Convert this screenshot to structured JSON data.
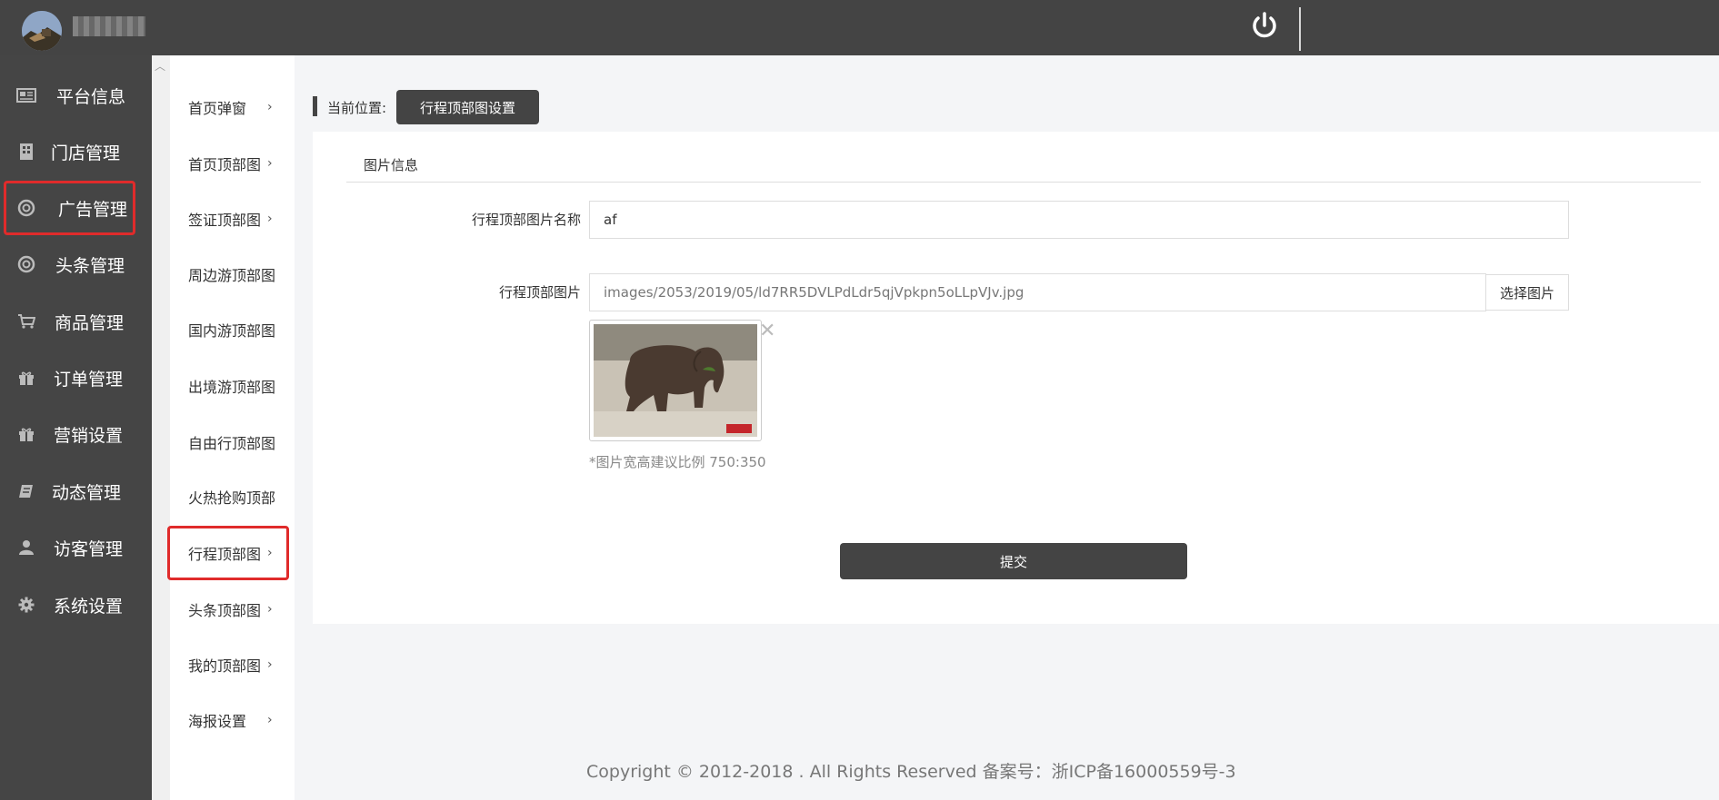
{
  "header": {
    "avatar_icon": "user-avatar",
    "power_icon": "power-icon"
  },
  "sidebar": {
    "items": [
      {
        "label": "平台信息",
        "icon": "newspaper-icon"
      },
      {
        "label": "门店管理",
        "icon": "building-icon"
      },
      {
        "label": "广告管理",
        "icon": "lifebuoy-icon",
        "active": true
      },
      {
        "label": "头条管理",
        "icon": "lifebuoy-icon"
      },
      {
        "label": "商品管理",
        "icon": "cart-icon"
      },
      {
        "label": "订单管理",
        "icon": "gift-icon"
      },
      {
        "label": "营销设置",
        "icon": "gift-icon"
      },
      {
        "label": "动态管理",
        "icon": "book-icon"
      },
      {
        "label": "访客管理",
        "icon": "user-icon"
      },
      {
        "label": "系统设置",
        "icon": "gear-icon"
      }
    ]
  },
  "subnav": {
    "items": [
      {
        "label": "首页弹窗",
        "chevron": true
      },
      {
        "label": "首页顶部图",
        "chevron": true
      },
      {
        "label": "签证顶部图",
        "chevron": true
      },
      {
        "label": "周边游顶部图",
        "chevron": false
      },
      {
        "label": "国内游顶部图",
        "chevron": false
      },
      {
        "label": "出境游顶部图",
        "chevron": false
      },
      {
        "label": "自由行顶部图",
        "chevron": false
      },
      {
        "label": "火热抢购顶部",
        "chevron": false
      },
      {
        "label": "行程顶部图",
        "chevron": true,
        "active": true
      },
      {
        "label": "头条顶部图",
        "chevron": true
      },
      {
        "label": "我的顶部图",
        "chevron": true
      },
      {
        "label": "海报设置",
        "chevron": true
      }
    ]
  },
  "breadcrumb": {
    "label": "当前位置:",
    "current": "行程顶部图设置"
  },
  "form": {
    "section_title": "图片信息",
    "name_label": "行程顶部图片名称",
    "name_value": "af",
    "image_label": "行程顶部图片",
    "image_path": "images/2053/2019/05/ld7RR5DVLPdLdr5qjVpkpn5oLLpVJv.jpg",
    "pick_button": "选择图片",
    "remove_icon": "close-icon",
    "hint": "*图片宽高建议比例 750:350",
    "submit": "提交"
  },
  "footer": {
    "text": "Copyright © 2012-2018 . All Rights Reserved 备案号：浙ICP备16000559号-3"
  },
  "colors": {
    "topbar": "#444444",
    "sidebar": "#454545",
    "highlight": "#e02b2b",
    "button": "#444444"
  }
}
